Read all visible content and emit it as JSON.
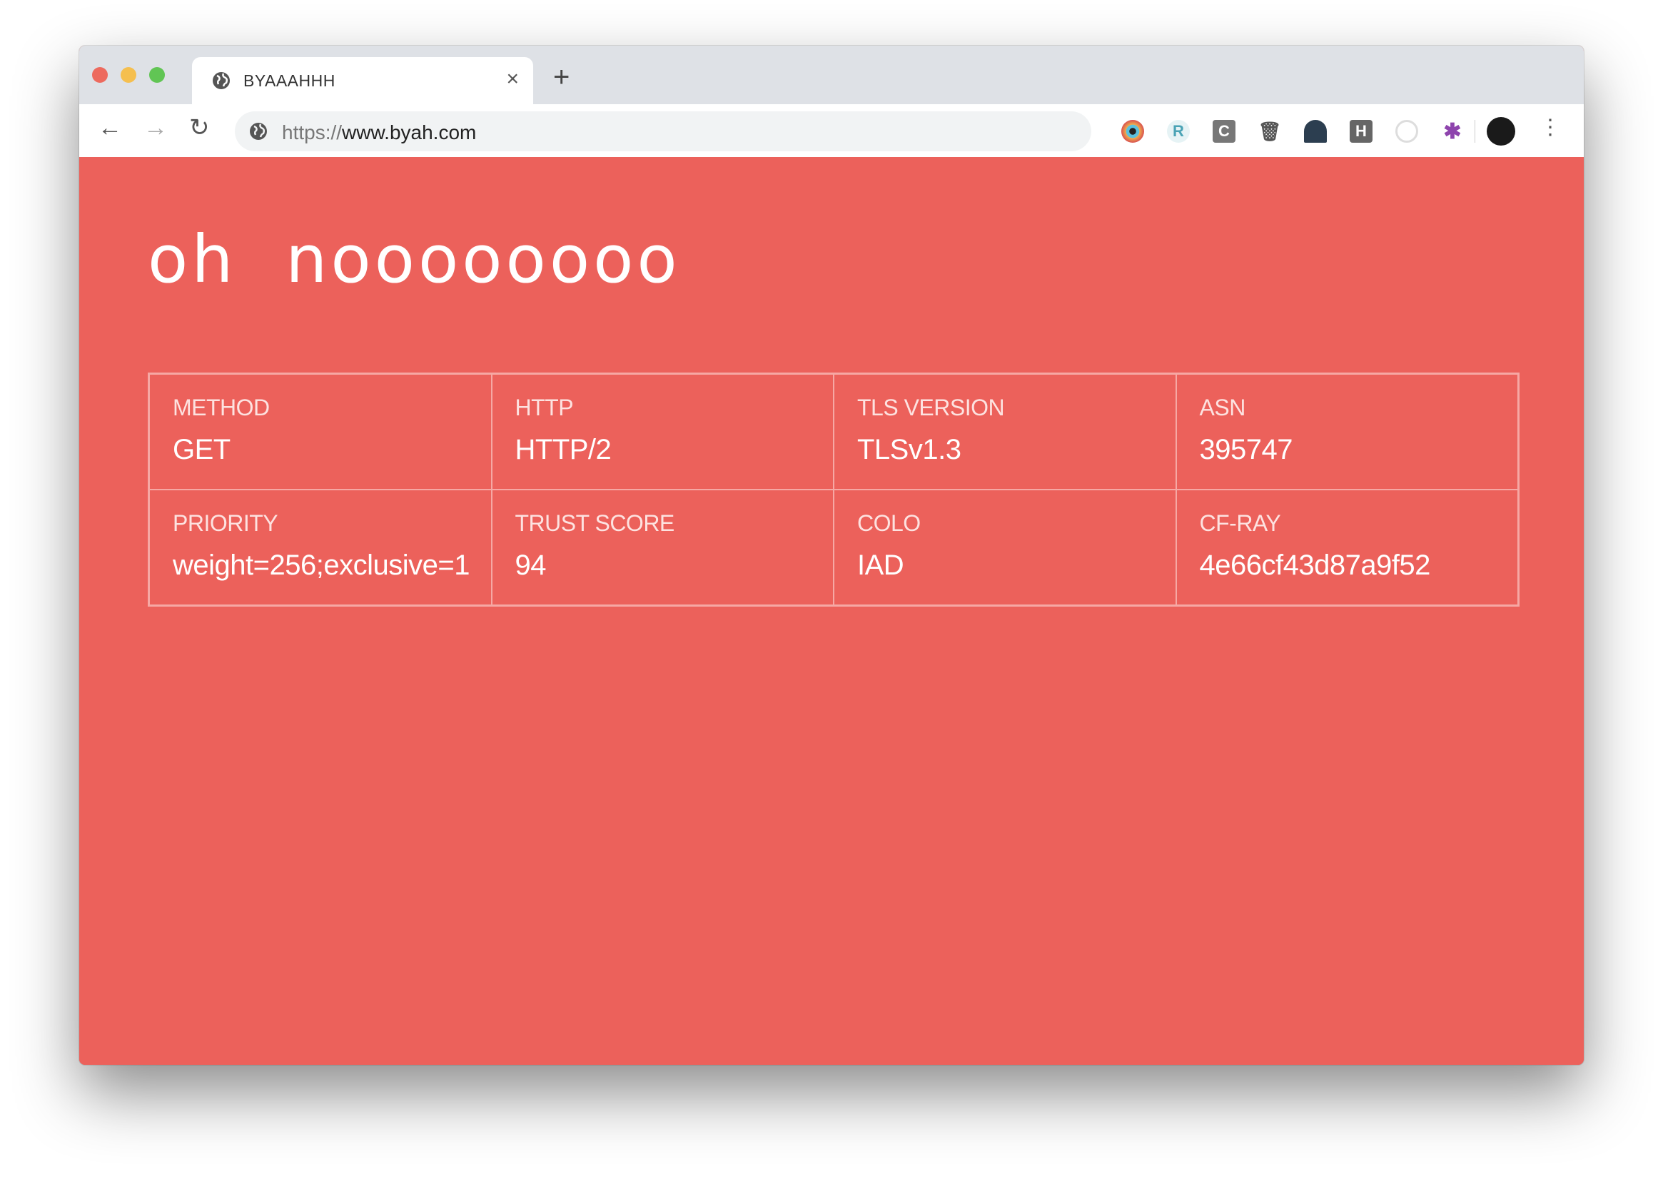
{
  "browser": {
    "tab_title": "BYAAAHHH",
    "tab_icon": "globe-icon",
    "url_scheme": "https://",
    "url_host": "www.byah.com",
    "extensions": [
      "eye-extension-icon",
      "r-extension-icon",
      "c-extension-icon",
      "trash-extension-icon",
      "spy-extension-icon",
      "h-extension-icon",
      "target-extension-icon",
      "pinwheel-extension-icon"
    ],
    "ext_c_label": "C",
    "ext_h_label": "H"
  },
  "page": {
    "background": "#ec615b",
    "heading": "oh  noooooooo",
    "cells": [
      {
        "label": "METHOD",
        "value": "GET"
      },
      {
        "label": "HTTP",
        "value": "HTTP/2"
      },
      {
        "label": "TLS VERSION",
        "value": "TLSv1.3"
      },
      {
        "label": "ASN",
        "value": "395747"
      },
      {
        "label": "PRIORITY",
        "value": "weight=256;exclusive=1"
      },
      {
        "label": "TRUST SCORE",
        "value": "94"
      },
      {
        "label": "COLO",
        "value": "IAD"
      },
      {
        "label": "CF-RAY",
        "value": "4e66cf43d87a9f52"
      }
    ]
  }
}
